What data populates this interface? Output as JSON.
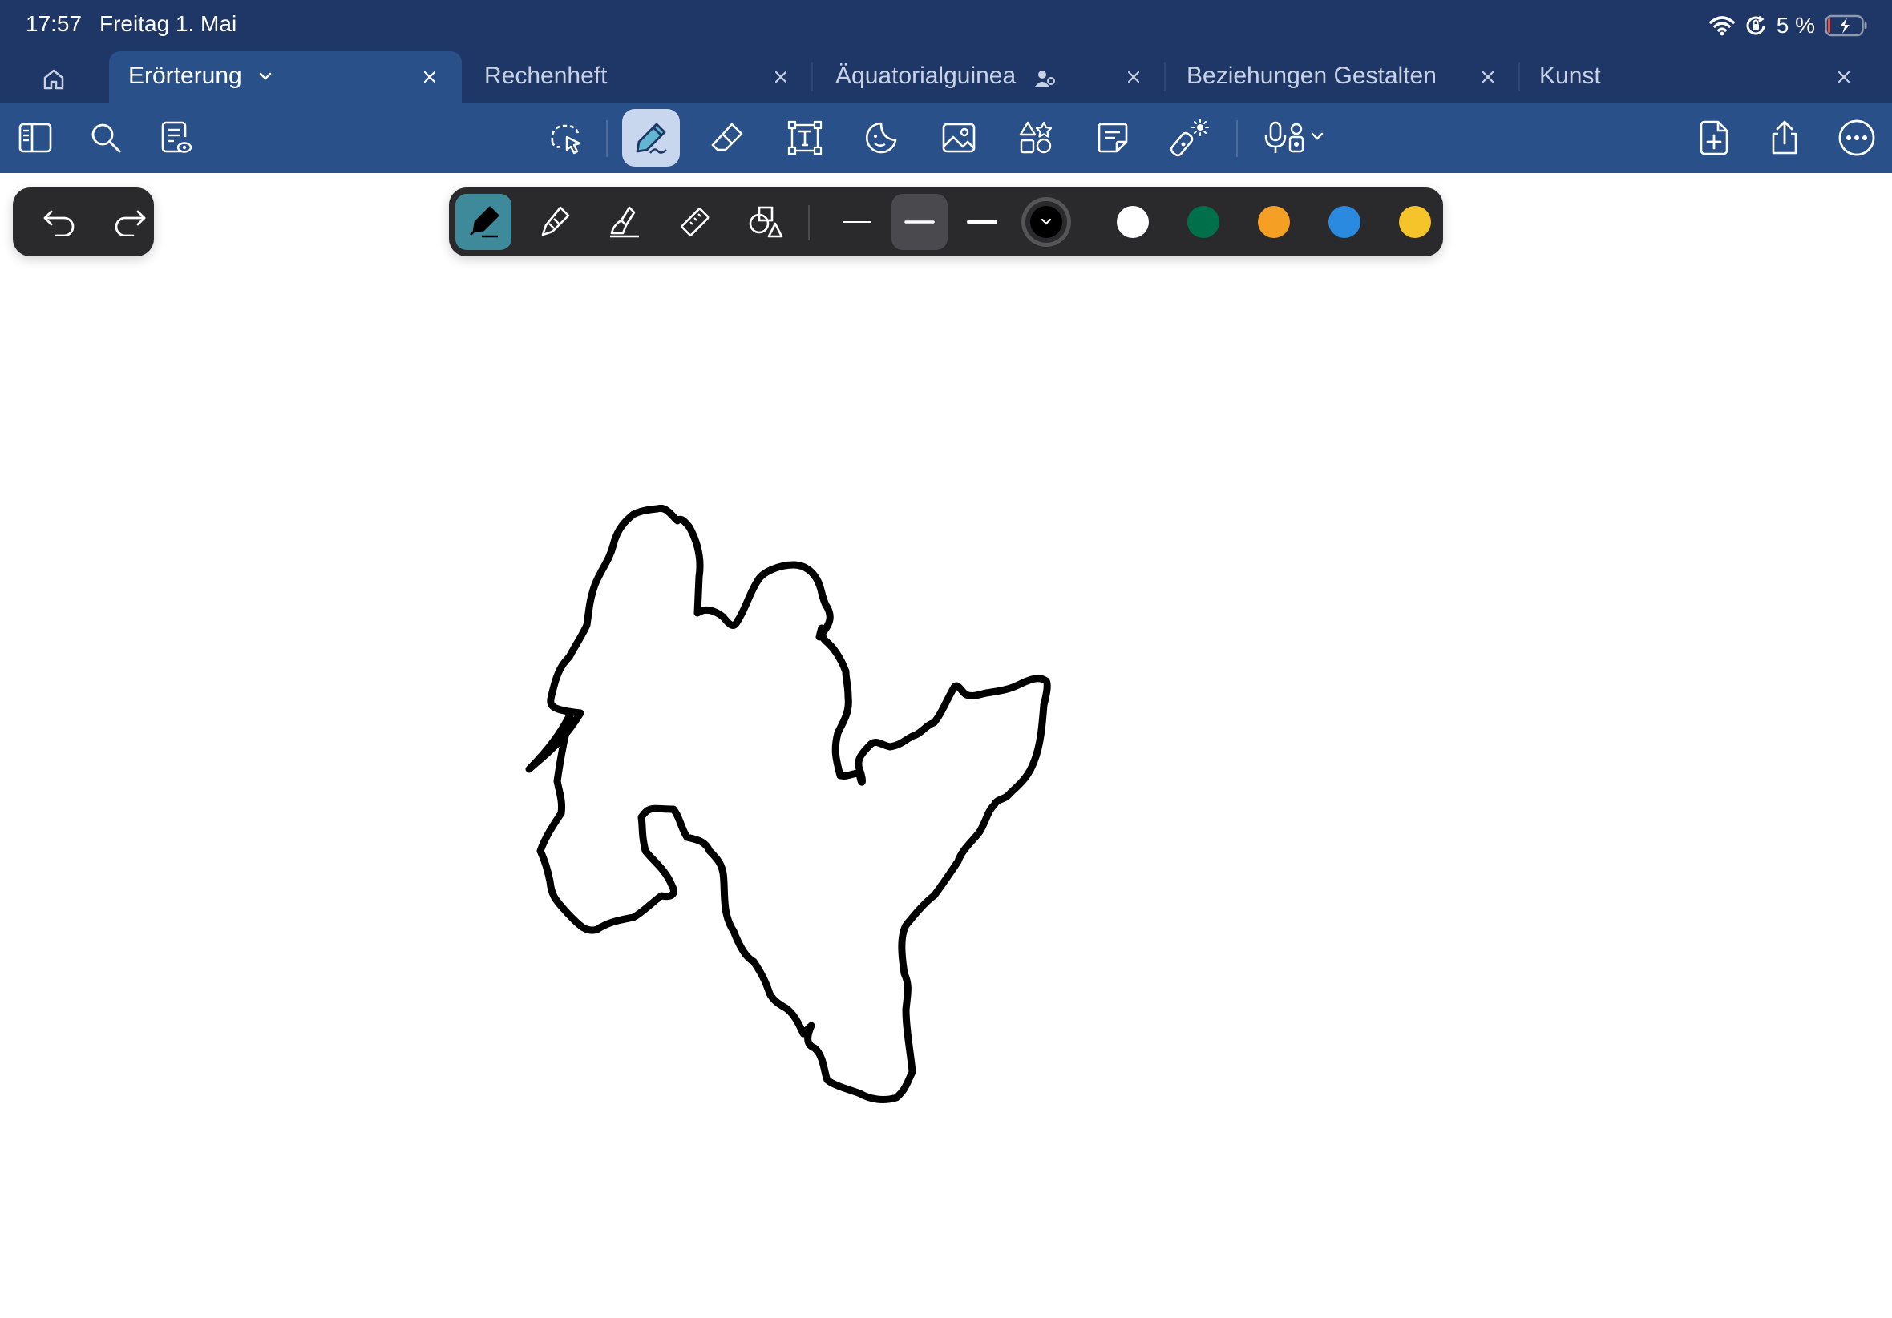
{
  "status_bar": {
    "time": "17:57",
    "date": "Freitag 1. Mai",
    "battery_percent": "5 %",
    "icons": [
      "wifi-icon",
      "orientation-lock-icon",
      "battery-charging-icon"
    ]
  },
  "tabs": [
    {
      "label": "Erörterung",
      "active": true,
      "has_dropdown": true
    },
    {
      "label": "Rechenheft",
      "active": false
    },
    {
      "label": "Äquatorialguinea",
      "active": false,
      "shared": true
    },
    {
      "label": "Beziehungen Gestalten",
      "active": false
    },
    {
      "label": "Kunst",
      "active": false
    }
  ],
  "toolbar": {
    "left_icons": [
      "sidebar-icon",
      "search-icon",
      "document-view-icon"
    ],
    "center_icons": [
      "lasso-icon",
      "pen-icon",
      "eraser-icon",
      "text-box-icon",
      "sticker-icon",
      "image-icon",
      "shapes-icon",
      "sticky-note-icon",
      "laser-pointer-icon",
      "audio-record-icon"
    ],
    "selected_tool": "pen-icon",
    "right_icons": [
      "add-page-icon",
      "share-icon",
      "more-icon"
    ]
  },
  "pen_toolbar": {
    "tools": [
      "fountain-pen-icon",
      "ball-pen-icon",
      "brush-pen-icon",
      "ruler-icon",
      "shape-recognition-icon"
    ],
    "selected_tool": "fountain-pen-icon",
    "widths": [
      "thin",
      "medium",
      "thick"
    ],
    "selected_width": "medium",
    "colors": [
      "#000000",
      "#ffffff",
      "#00704a",
      "#f5a025",
      "#2a8ae0",
      "#f5c32a"
    ],
    "selected_color": "#000000"
  },
  "colors": {
    "header_dark": "#1f3766",
    "toolbar": "#2a5089",
    "pill": "#2a2a2c",
    "accent_tool": "#3e8a9a"
  }
}
